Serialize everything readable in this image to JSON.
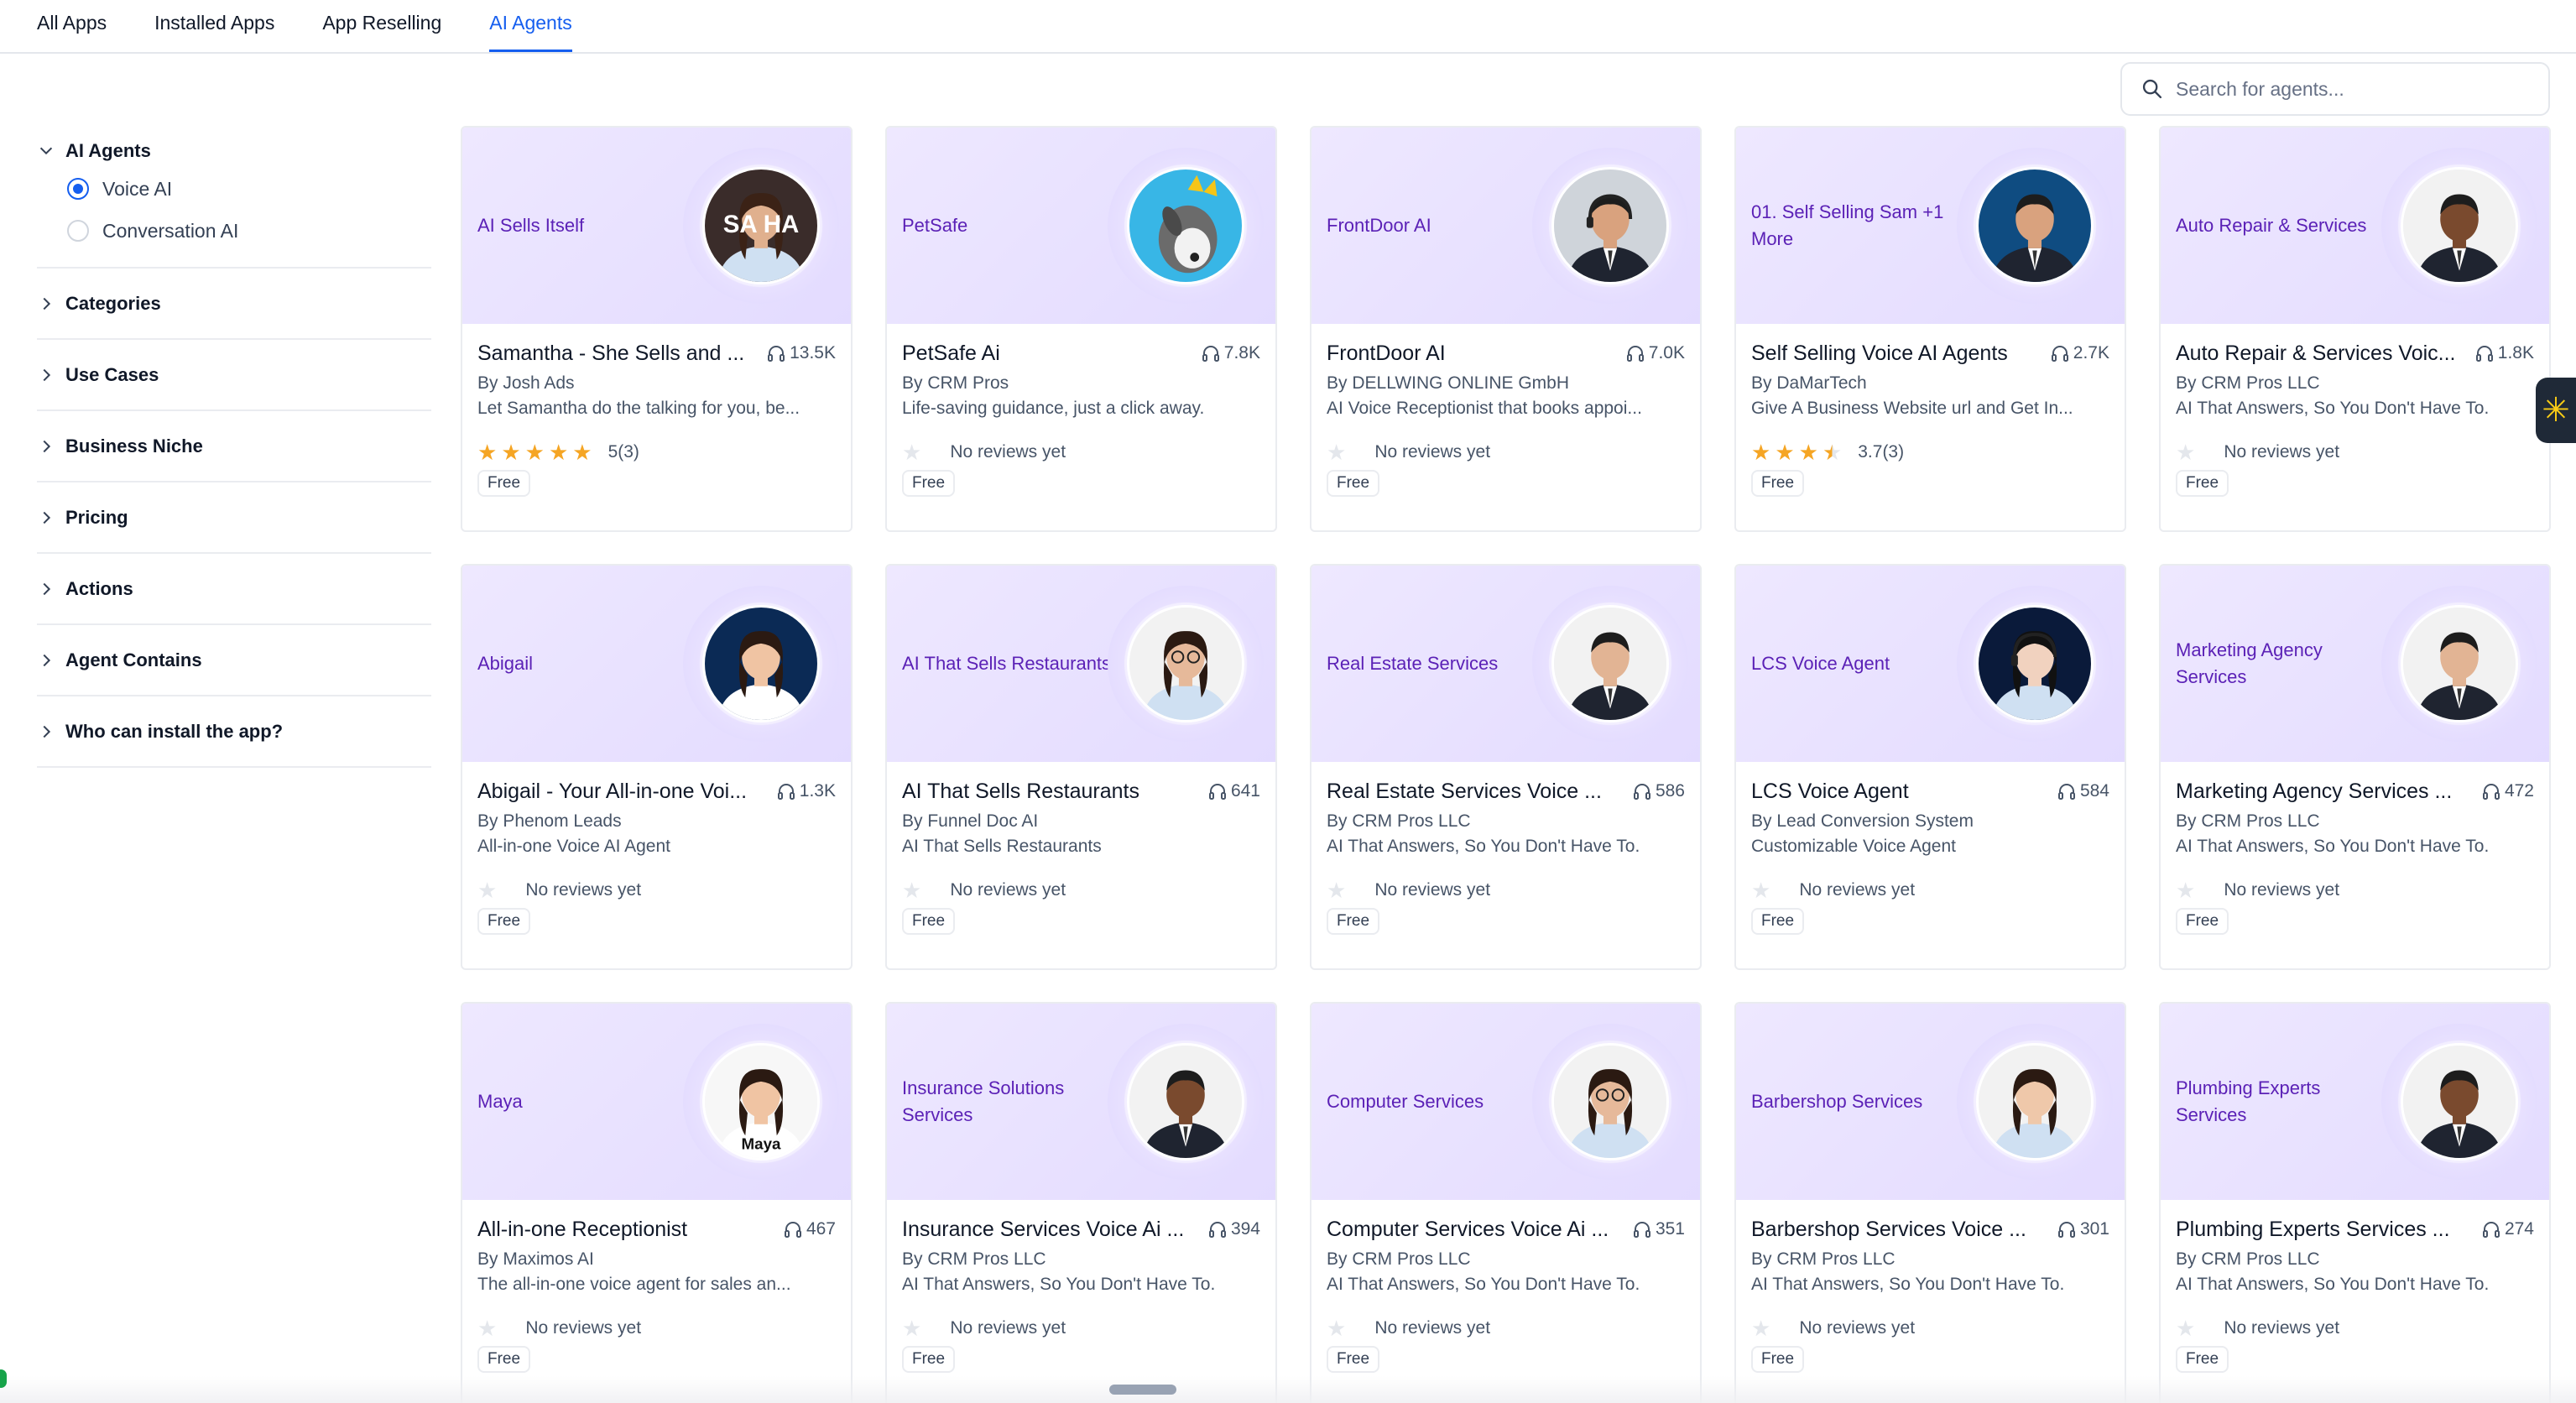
{
  "tabs": [
    {
      "label": "All Apps",
      "active": false
    },
    {
      "label": "Installed Apps",
      "active": false
    },
    {
      "label": "App Reselling",
      "active": false
    },
    {
      "label": "AI Agents",
      "active": true
    }
  ],
  "search": {
    "placeholder": "Search for agents...",
    "icon": "search-icon"
  },
  "sidebar": {
    "ai_agents": {
      "label": "AI Agents",
      "options": [
        {
          "label": "Voice AI",
          "selected": true
        },
        {
          "label": "Conversation AI",
          "selected": false
        }
      ]
    },
    "filters": [
      "Categories",
      "Use Cases",
      "Business Niche",
      "Pricing",
      "Actions",
      "Agent Contains",
      "Who can install the app?"
    ]
  },
  "accent_color": "#155eef",
  "banner_text_color": "#5b21b6",
  "star_color": "#f5a524",
  "cards": [
    {
      "banner": "AI Sells Itself",
      "title": "Samantha - She Sells and ...",
      "installs": "13.5K",
      "author": "By Josh Ads",
      "desc": "Let Samantha do the talking for you, be...",
      "stars": 5,
      "rating_text": "5(3)",
      "price": "Free",
      "avatar": "woman-photo",
      "avatar_overlay": "SA  HA"
    },
    {
      "banner": "PetSafe",
      "title": "PetSafe Ai",
      "installs": "7.8K",
      "author": "By CRM Pros",
      "desc": "Life-saving guidance, just a click away.",
      "stars": 0,
      "rating_text": "No reviews yet",
      "price": "Free",
      "avatar": "dog-photo"
    },
    {
      "banner": "FrontDoor AI",
      "title": "FrontDoor AI",
      "installs": "7.0K",
      "author": "By DELLWING ONLINE GmbH",
      "desc": "AI Voice Receptionist that books appoi...",
      "stars": 0,
      "rating_text": "No reviews yet",
      "price": "Free",
      "avatar": "man-headset-photo"
    },
    {
      "banner": "01. Self Selling Sam +1 More",
      "title": "Self Selling Voice AI Agents",
      "installs": "2.7K",
      "author": "By DaMarTech",
      "desc": "Give A Business Website url and Get In...",
      "stars": 3.5,
      "rating_text": "3.7(3)",
      "price": "Free",
      "avatar": "man-presenting-photo"
    },
    {
      "banner": "Auto Repair & Services",
      "title": "Auto Repair & Services Voic...",
      "installs": "1.8K",
      "author": "By CRM Pros LLC",
      "desc": "AI That Answers, So You Don't Have To.",
      "stars": 0,
      "rating_text": "No reviews yet",
      "price": "Free",
      "avatar": "man-suit-dark"
    },
    {
      "banner": "Abigail",
      "title": "Abigail - Your All-in-one Voi...",
      "installs": "1.3K",
      "author": "By Phenom Leads",
      "desc": "All-in-one Voice AI Agent",
      "stars": 0,
      "rating_text": "No reviews yet",
      "price": "Free",
      "avatar": "woman-cartoon"
    },
    {
      "banner": "AI That Sells Restaurants",
      "title": "AI That Sells Restaurants",
      "installs": "641",
      "author": "By Funnel Doc AI",
      "desc": "AI That Sells Restaurants",
      "stars": 0,
      "rating_text": "No reviews yet",
      "price": "Free",
      "avatar": "woman-glasses"
    },
    {
      "banner": "Real Estate Services",
      "title": "Real Estate Services Voice ...",
      "installs": "586",
      "author": "By CRM Pros LLC",
      "desc": "AI That Answers, So You Don't Have To.",
      "stars": 0,
      "rating_text": "No reviews yet",
      "price": "Free",
      "avatar": "man-suit-light"
    },
    {
      "banner": "LCS Voice Agent",
      "title": "LCS Voice Agent",
      "installs": "584",
      "author": "By Lead Conversion System",
      "desc": "Customizable Voice Agent",
      "stars": 0,
      "rating_text": "No reviews yet",
      "price": "Free",
      "avatar": "woman-headset-robot"
    },
    {
      "banner": "Marketing Agency Services",
      "title": "Marketing Agency Services ...",
      "installs": "472",
      "author": "By CRM Pros LLC",
      "desc": "AI That Answers, So You Don't Have To.",
      "stars": 0,
      "rating_text": "No reviews yet",
      "price": "Free",
      "avatar": "man-suit-light"
    },
    {
      "banner": "Maya",
      "title": "All-in-one Receptionist",
      "installs": "467",
      "author": "By Maximos AI",
      "desc": "The all-in-one voice agent for sales an...",
      "stars": 0,
      "rating_text": "No reviews yet",
      "price": "Free",
      "avatar": "woman-cartoon-maya",
      "avatar_overlay": "Maya"
    },
    {
      "banner": "Insurance Solutions Services",
      "title": "Insurance Services Voice Ai ...",
      "installs": "394",
      "author": "By CRM Pros LLC",
      "desc": "AI That Answers, So You Don't Have To.",
      "stars": 0,
      "rating_text": "No reviews yet",
      "price": "Free",
      "avatar": "man-suit-dark"
    },
    {
      "banner": "Computer Services",
      "title": "Computer Services Voice Ai ...",
      "installs": "351",
      "author": "By CRM Pros LLC",
      "desc": "AI That Answers, So You Don't Have To.",
      "stars": 0,
      "rating_text": "No reviews yet",
      "price": "Free",
      "avatar": "woman-glasses"
    },
    {
      "banner": "Barbershop Services",
      "title": "Barbershop Services Voice ...",
      "installs": "301",
      "author": "By CRM Pros LLC",
      "desc": "AI That Answers, So You Don't Have To.",
      "stars": 0,
      "rating_text": "No reviews yet",
      "price": "Free",
      "avatar": "woman-light"
    },
    {
      "banner": "Plumbing Experts Services",
      "title": "Plumbing Experts Services ...",
      "installs": "274",
      "author": "By CRM Pros LLC",
      "desc": "AI That Answers, So You Don't Have To.",
      "stars": 0,
      "rating_text": "No reviews yet",
      "price": "Free",
      "avatar": "man-suit-dark"
    }
  ]
}
